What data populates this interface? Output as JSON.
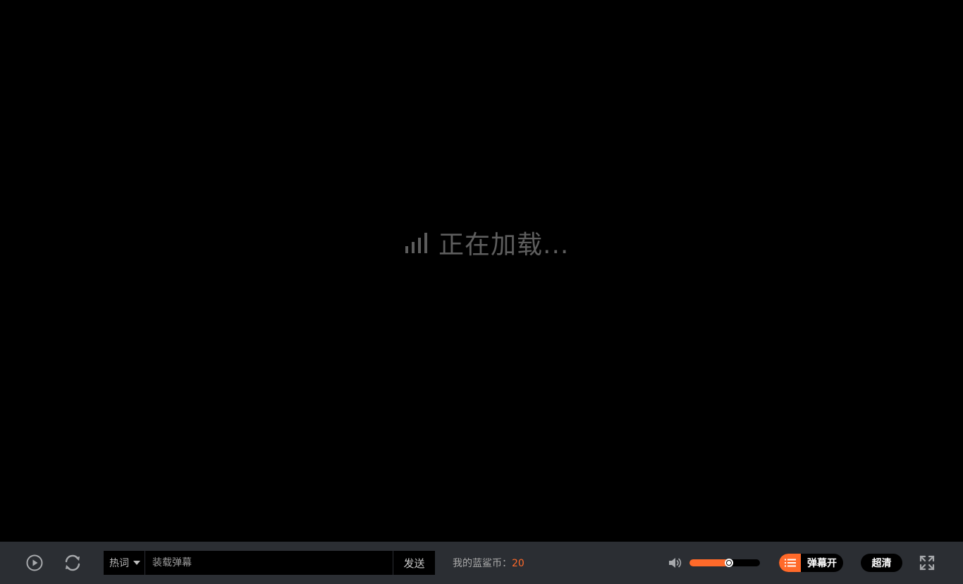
{
  "player": {
    "loading_text": "正在加载...",
    "danmu": {
      "hotword_label": "热词",
      "input_placeholder": "装载弹幕",
      "input_value": "",
      "send_label": "发送"
    },
    "coins": {
      "label": "我的蓝鲨币：",
      "value": "20"
    },
    "volume": {
      "level_percent": 56
    },
    "danmu_toggle_label": "弹幕开",
    "quality_label": "超清",
    "icons": {
      "loading": "signal-bars-icon",
      "play": "play-icon",
      "refresh": "refresh-icon",
      "hotword_dropdown": "caret-down-icon",
      "volume": "speaker-icon",
      "danmu": "danmu-list-icon",
      "fullscreen": "fullscreen-icon"
    },
    "colors": {
      "accent": "#ff6a2a",
      "controlbar_bg": "#2b2e33",
      "video_bg": "#000000"
    }
  }
}
